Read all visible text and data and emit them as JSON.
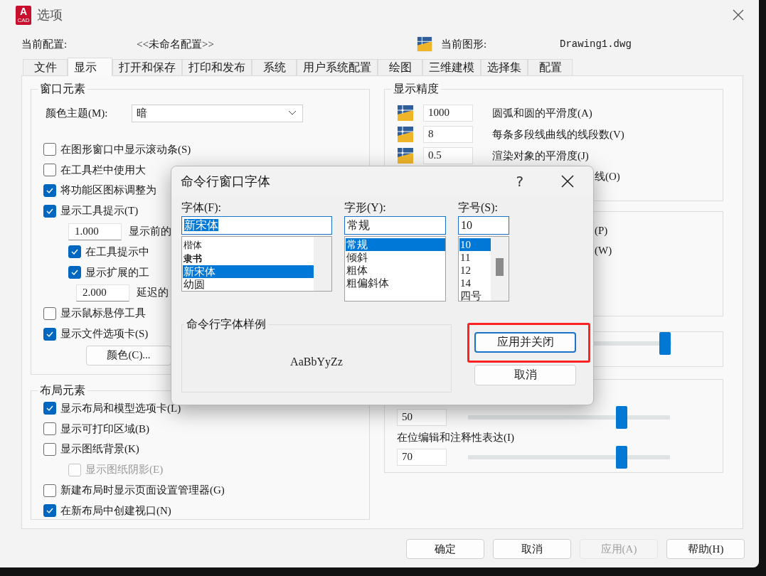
{
  "window": {
    "title": "选项",
    "app_icon": {
      "letter": "A",
      "caption": "CAD"
    }
  },
  "profile": {
    "label": "当前配置:",
    "value": "<<未命名配置>>"
  },
  "drawing": {
    "label": "当前图形:",
    "value": "Drawing1.dwg"
  },
  "tabs": [
    {
      "label": "文件",
      "selected": false
    },
    {
      "label": "显示",
      "selected": true
    },
    {
      "label": "打开和保存",
      "selected": false
    },
    {
      "label": "打印和发布",
      "selected": false
    },
    {
      "label": "系统",
      "selected": false
    },
    {
      "label": "用户系统配置",
      "selected": false
    },
    {
      "label": "绘图",
      "selected": false
    },
    {
      "label": "三维建模",
      "selected": false
    },
    {
      "label": "选择集",
      "selected": false
    },
    {
      "label": "配置",
      "selected": false
    }
  ],
  "window_elements": {
    "title": "窗口元素",
    "theme": {
      "label": "颜色主题(M):",
      "value": "暗"
    },
    "options": [
      {
        "kind": "check",
        "label": "在图形窗口中显示滚动条(S)",
        "checked": false,
        "disabled": false
      },
      {
        "kind": "check",
        "label": "在工具栏中使用大",
        "checked": false,
        "disabled": false
      },
      {
        "kind": "check",
        "label": "将功能区图标调整为",
        "checked": true,
        "disabled": false
      },
      {
        "kind": "check",
        "label": "显示工具提示(T)",
        "checked": true,
        "disabled": false,
        "children": [
          {
            "kind": "number",
            "value": "1.000",
            "label": "显示前的"
          },
          {
            "kind": "check",
            "label": "在工具提示中",
            "checked": true,
            "disabled": false
          },
          {
            "kind": "check",
            "label": "显示扩展的工",
            "checked": true,
            "disabled": false,
            "children": [
              {
                "kind": "number",
                "value": "2.000",
                "label": "延迟的"
              }
            ]
          }
        ]
      },
      {
        "kind": "check",
        "label": "显示鼠标悬停工具",
        "checked": false,
        "disabled": false
      },
      {
        "kind": "check",
        "label": "显示文件选项卡(S)",
        "checked": true,
        "disabled": false
      }
    ],
    "colors_button": "颜色(C)..."
  },
  "layout_elements": {
    "title": "布局元素",
    "options": [
      {
        "kind": "check",
        "label": "显示布局和模型选项卡(L)",
        "checked": true,
        "disabled": false
      },
      {
        "kind": "check",
        "label": "显示可打印区域(B)",
        "checked": false,
        "disabled": false
      },
      {
        "kind": "check",
        "label": "显示图纸背景(K)",
        "checked": false,
        "disabled": false,
        "children": [
          {
            "kind": "check",
            "label": "显示图纸阴影(E)",
            "checked": false,
            "disabled": true
          }
        ]
      },
      {
        "kind": "check",
        "label": "新建布局时显示页面设置管理器(G)",
        "checked": false,
        "disabled": false
      },
      {
        "kind": "check",
        "label": "在新布局中创建视口(N)",
        "checked": true,
        "disabled": false
      }
    ]
  },
  "display_resolution": {
    "title": "显示精度",
    "rows": [
      {
        "value": "1000",
        "label": "圆弧和圆的平滑度(A)"
      },
      {
        "value": "8",
        "label": "每条多段线曲线的线段数(V)"
      },
      {
        "value": "0.5",
        "label": "渲染对象的平滑度(J)"
      }
    ],
    "fragment": "线(O)"
  },
  "display_performance": {
    "fragments": [
      "(P)",
      "(W)"
    ]
  },
  "fade_control": {
    "sliders": [
      {
        "level": 0.97
      }
    ],
    "rows": [
      {
        "value": "50",
        "level": 0.76
      },
      {
        "label": "在位编辑和注释性表达(I)",
        "value": "70",
        "level": 0.76
      }
    ]
  },
  "buttons": [
    {
      "label": "确定",
      "disabled": false
    },
    {
      "label": "取消",
      "disabled": false
    },
    {
      "label": "应用(A)",
      "disabled": true
    },
    {
      "label": "帮助(H)",
      "disabled": false
    }
  ],
  "font_dialog": {
    "title": "命令行窗口字体",
    "help": "?",
    "font": {
      "label": "字体(F):",
      "value": "新宋体",
      "value_selected": true,
      "items": [
        {
          "label": "楷体",
          "selected": false
        },
        {
          "label": "隶书",
          "selected": false
        },
        {
          "label": "新宋体",
          "selected": true
        },
        {
          "label": "幼圆",
          "selected": false
        }
      ]
    },
    "style": {
      "label": "字形(Y):",
      "value": "常规",
      "items": [
        {
          "label": "常规",
          "selected": true
        },
        {
          "label": "倾斜",
          "selected": false
        },
        {
          "label": "粗体",
          "selected": false
        },
        {
          "label": "粗偏斜体",
          "selected": false
        }
      ]
    },
    "size": {
      "label": "字号(S):",
      "value": "10",
      "items": [
        {
          "label": "10",
          "selected": true
        },
        {
          "label": "11",
          "selected": false
        },
        {
          "label": "12",
          "selected": false
        },
        {
          "label": "14",
          "selected": false
        },
        {
          "label": "四号",
          "selected": false
        }
      ]
    },
    "sample": {
      "title": "命令行字体样例",
      "text": "AaBbYyZz"
    },
    "buttons": [
      {
        "label": "应用并关闭",
        "default": true,
        "highlighted": true
      },
      {
        "label": "取消",
        "default": false,
        "highlighted": false
      }
    ]
  }
}
